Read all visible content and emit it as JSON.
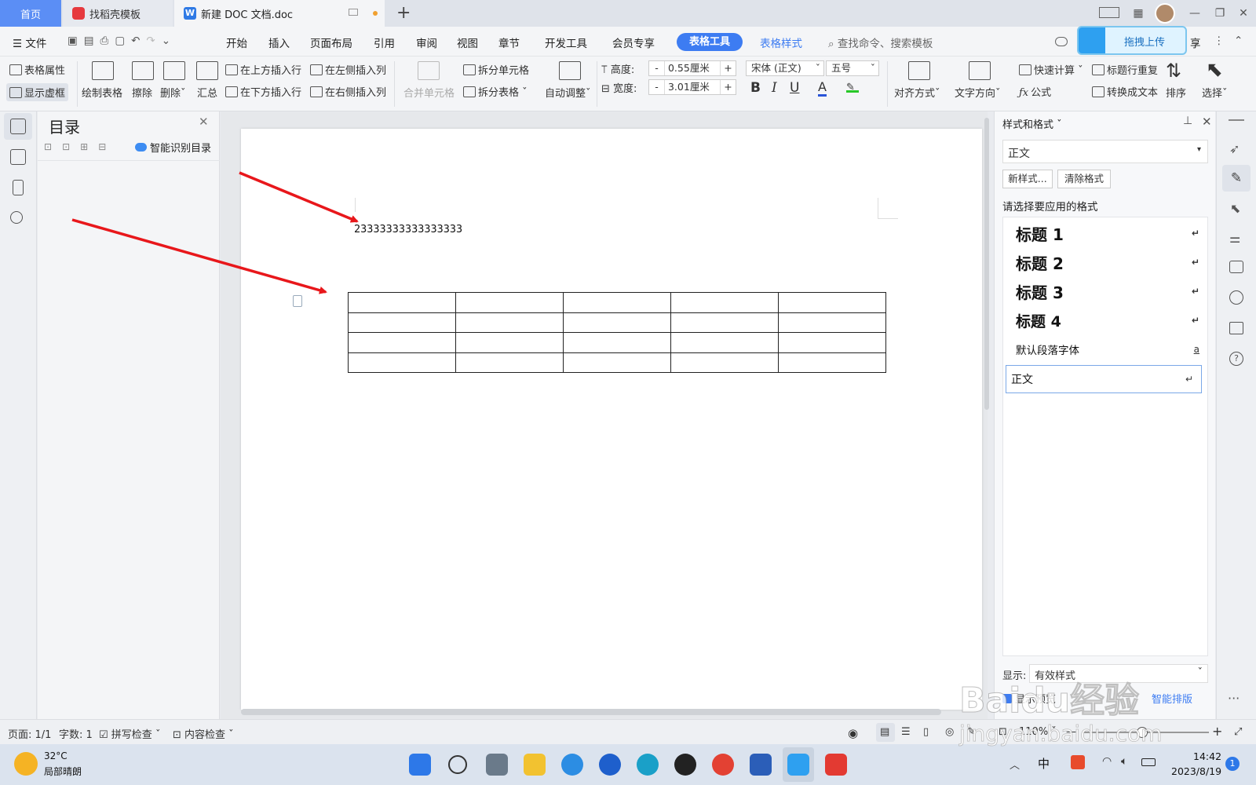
{
  "tabs": {
    "home": "首页",
    "daoke": "找稻壳模板",
    "doc": "新建 DOC 文档.doc",
    "add": "+"
  },
  "menu": {
    "file": "文件",
    "items": [
      "开始",
      "插入",
      "页面布局",
      "引用",
      "审阅",
      "视图",
      "章节",
      "开发工具",
      "会员专享"
    ],
    "table_tools": "表格工具",
    "table_style": "表格样式",
    "search_placeholder": "查找命令、搜索模板",
    "upload": "拖拽上传",
    "share_fragment": "享"
  },
  "ribbon": {
    "table_props": "表格属性",
    "show_grid": "显示虚框",
    "draw_table": "绘制表格",
    "erase": "擦除",
    "delete": "删除",
    "summary": "汇总",
    "insert_above": "在上方插入行",
    "insert_below": "在下方插入行",
    "insert_left": "在左侧插入列",
    "insert_right": "在右侧插入列",
    "merge_cells": "合并单元格",
    "split_cells": "拆分单元格",
    "split_table": "拆分表格",
    "auto_fit": "自动调整",
    "height_label": "高度:",
    "height_value": "0.55厘米",
    "width_label": "宽度:",
    "width_value": "3.01厘米",
    "font": "宋体 (正文)",
    "font_size": "五号",
    "bold": "B",
    "italic": "I",
    "underline": "U",
    "font_color": "A",
    "align": "对齐方式",
    "text_dir": "文字方向",
    "quick_calc": "快速计算",
    "formula": "公式",
    "header_repeat": "标题行重复",
    "to_text": "转换成文本",
    "sort": "排序",
    "select": "选择"
  },
  "toc": {
    "title": "目录",
    "smart": "智能识别目录"
  },
  "document": {
    "text": "23333333333333333",
    "rows": 4,
    "cols": 5
  },
  "style_pane": {
    "title": "样式和格式",
    "current": "正文",
    "new_style": "新样式...",
    "clear_format": "清除格式",
    "prompt": "请选择要应用的格式",
    "styles": [
      {
        "name": "标题 1",
        "mark": "↵"
      },
      {
        "name": "标题 2",
        "mark": "↵"
      },
      {
        "name": "标题 3",
        "mark": "↵"
      },
      {
        "name": "标题 4",
        "mark": "↵"
      },
      {
        "name": "默认段落字体",
        "mark": "a"
      },
      {
        "name": "正文",
        "mark": "↵"
      }
    ],
    "show_label": "显示:",
    "show_value": "有效样式",
    "preview": "显示预览",
    "smart_layout": "智能排版"
  },
  "status": {
    "page": "页面: 1/1",
    "words": "字数: 1",
    "spell": "拼写检查",
    "content_check": "内容检查",
    "zoom": "110%"
  },
  "taskbar": {
    "temp": "32°C",
    "weather": "局部晴朗",
    "ime": "中",
    "time": "14:42",
    "date": "2023/8/19",
    "badge": "1"
  },
  "watermark": {
    "brand": "Baidu经验",
    "url": "jingyan.baidu.com"
  },
  "colors": {
    "accent": "#3d7cf2",
    "home_tab": "#5b8ef5",
    "arrow": "#e8171b"
  }
}
